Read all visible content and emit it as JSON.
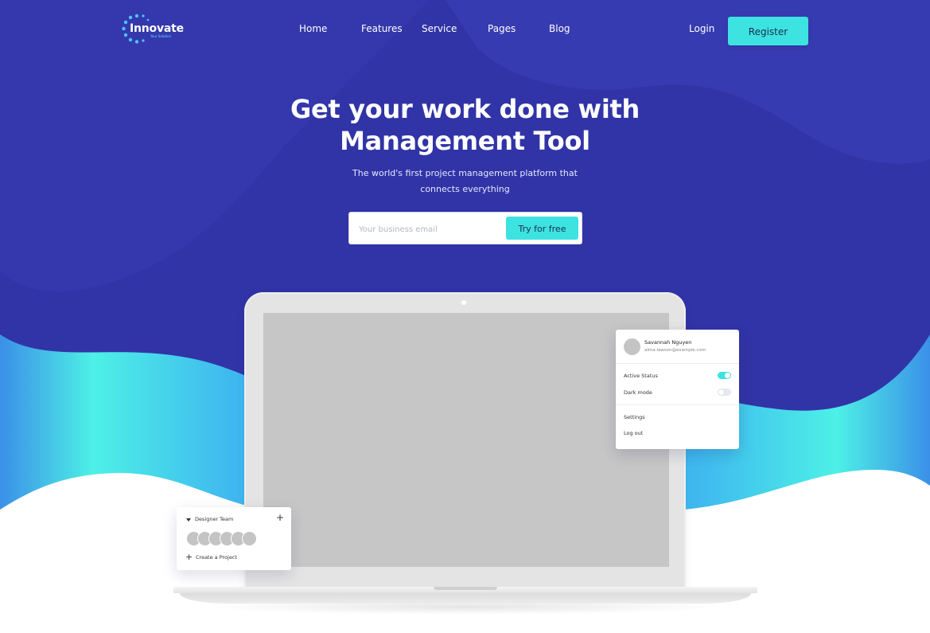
{
  "colors": {
    "hero_bg": "#3134a6",
    "hero_bg_light": "#3c3fb8",
    "cyan_start": "#3b8fe8",
    "cyan_mid": "#4df0e6",
    "accent": "#3de3e0",
    "white": "#ffffff"
  },
  "brand": {
    "name": "Innovate",
    "tagline": "Your Solution"
  },
  "nav": {
    "links": [
      "Home",
      "Features",
      "Service",
      "Pages",
      "Blog"
    ],
    "login_label": "Login",
    "register_label": "Register"
  },
  "hero": {
    "title_line1": "Get your work done with",
    "title_line2": "Management Tool",
    "subtitle_line1": "The world's first project management platform that",
    "subtitle_line2": "connects everything",
    "email_placeholder": "Your business email",
    "email_value": "",
    "cta_label": "Try for free"
  },
  "profile_menu": {
    "user_name": "Savannah Nguyen",
    "user_email": "alma.lawson@example.com",
    "active_status_label": "Active Status",
    "active_status_on": true,
    "dark_mode_label": "Dark mode",
    "dark_mode_on": false,
    "settings_label": "Settings",
    "logout_label": "Log out"
  },
  "team_card": {
    "title": "Designer Team",
    "member_count": 6,
    "create_label": "Create a Project"
  },
  "icons": {
    "logo": "dotted-circle-logo",
    "dropdown": "caret-down-icon",
    "add": "plus-icon"
  }
}
